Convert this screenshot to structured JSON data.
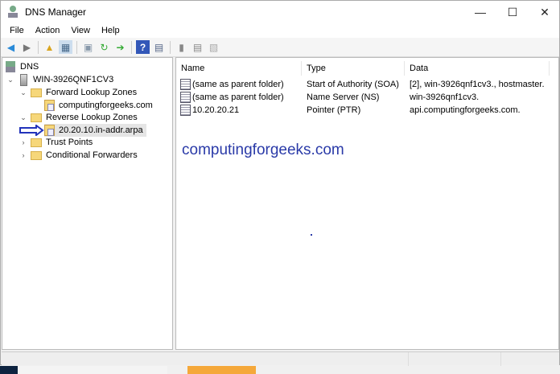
{
  "window": {
    "title": "DNS Manager",
    "minimize": "—",
    "maximize": "☐",
    "close": "✕"
  },
  "menu": [
    "File",
    "Action",
    "View",
    "Help"
  ],
  "tree": {
    "root": "DNS",
    "server": "WIN-3926QNF1CV3",
    "forward": "Forward Lookup Zones",
    "forward_zone": "computingforgeeks.com",
    "reverse": "Reverse Lookup Zones",
    "reverse_zone": "20.20.10.in-addr.arpa",
    "trust": "Trust Points",
    "conditional": "Conditional Forwarders"
  },
  "columns": [
    "Name",
    "Type",
    "Data"
  ],
  "records": [
    {
      "name": "(same as parent folder)",
      "type": "Start of Authority (SOA)",
      "data": "[2], win-3926qnf1cv3., hostmaster."
    },
    {
      "name": "(same as parent folder)",
      "type": "Name Server (NS)",
      "data": "win-3926qnf1cv3."
    },
    {
      "name": "10.20.20.21",
      "type": "Pointer (PTR)",
      "data": "api.computingforgeeks.com."
    }
  ],
  "watermark": "computingforgeeks.com",
  "colors": {
    "watermark": "#2a3aa8",
    "arrow": "#2233bb"
  }
}
